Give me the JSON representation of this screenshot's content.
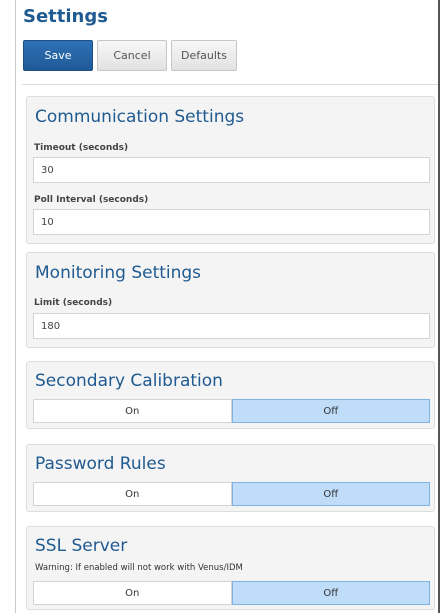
{
  "page": {
    "title": "Settings"
  },
  "toolbar": {
    "save_label": "Save",
    "cancel_label": "Cancel",
    "defaults_label": "Defaults"
  },
  "communication": {
    "title": "Communication Settings",
    "timeout_label": "Timeout (seconds)",
    "timeout_value": "30",
    "poll_label": "Poll Interval (seconds)",
    "poll_value": "10"
  },
  "monitoring": {
    "title": "Monitoring Settings",
    "limit_label": "Limit (seconds)",
    "limit_value": "180"
  },
  "secondary_calibration": {
    "title": "Secondary Calibration",
    "on_label": "On",
    "off_label": "Off",
    "selected": "Off"
  },
  "password_rules": {
    "title": "Password Rules",
    "on_label": "On",
    "off_label": "Off",
    "selected": "Off"
  },
  "ssl_server": {
    "title": "SSL Server",
    "warning": "Warning: If enabled will not work with Venus/IDM",
    "on_label": "On",
    "off_label": "Off",
    "selected": "Off"
  },
  "colors": {
    "accent": "#1f5a91",
    "toggle_selected": "#bfdcf8"
  }
}
